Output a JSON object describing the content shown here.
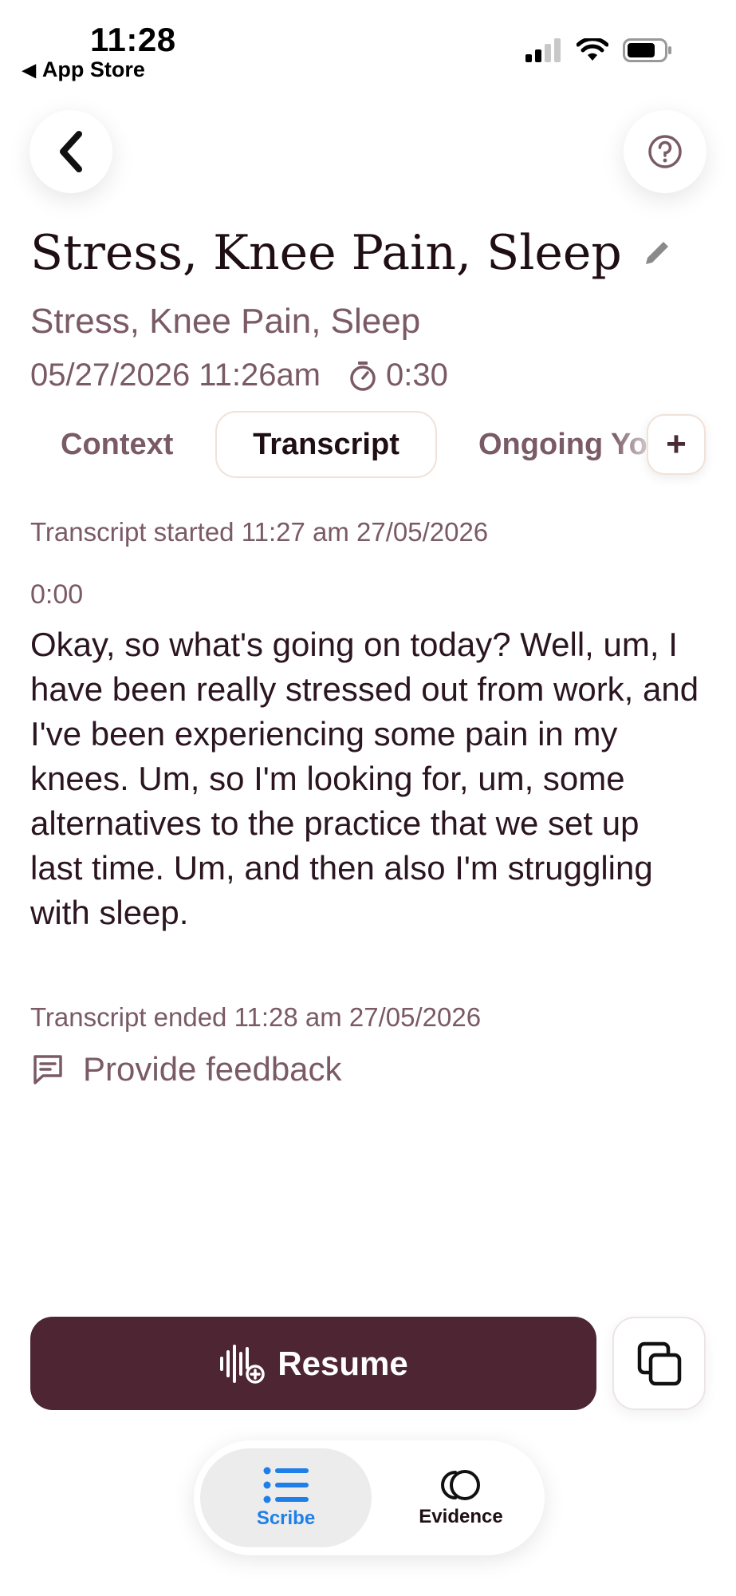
{
  "status_bar": {
    "time": "11:28",
    "back_app_label": "App Store"
  },
  "header": {
    "back_icon": "chevron-left-icon",
    "help_icon": "question-circle-icon"
  },
  "note": {
    "title": "Stress, Knee Pain, Sleep",
    "subtitle": "Stress, Knee Pain, Sleep",
    "datetime": "05/27/2026 11:26am",
    "duration": "0:30"
  },
  "tabs": [
    {
      "label": "Context",
      "active": false
    },
    {
      "label": "Transcript",
      "active": true
    },
    {
      "label": "Ongoing Yo",
      "active": false
    }
  ],
  "add_tab_label": "+",
  "transcript": {
    "started": "Transcript started 11:27 am 27/05/2026",
    "segment_time": "0:00",
    "text": "Okay, so what's going on today? Well, um, I have been really stressed out from work, and I've been experiencing some pain in my knees. Um, so I'm looking for, um, some alternatives to the practice that we set up last time. Um, and then also I'm struggling with sleep.",
    "ended": "Transcript ended 11:28 am 27/05/2026"
  },
  "feedback_label": "Provide feedback",
  "actions": {
    "resume_label": "Resume",
    "copy_icon": "copy-icon"
  },
  "bottom_nav": [
    {
      "label": "Scribe",
      "active": true
    },
    {
      "label": "Evidence",
      "active": false
    }
  ],
  "colors": {
    "accent_dark": "#4e2533",
    "muted_text": "#7a5a66",
    "nav_active": "#1f7fe8"
  }
}
